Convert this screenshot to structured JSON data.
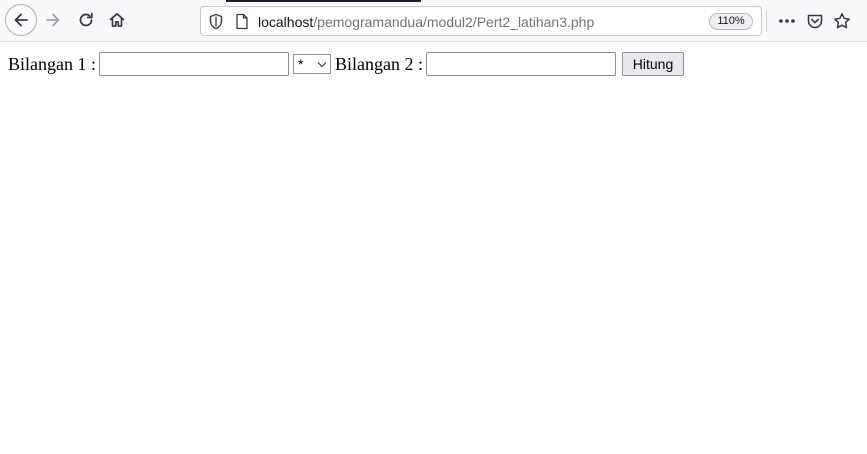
{
  "browser": {
    "url_host": "localhost",
    "url_path": "/pemogramandua/modul2/Pert2_latihan3.php",
    "zoom": "110%",
    "icons": [
      "back-arrow-icon",
      "forward-arrow-icon",
      "reload-icon",
      "home-icon",
      "shield-icon",
      "page-icon",
      "more-icon",
      "pocket-icon",
      "bookmark-star-icon"
    ]
  },
  "form": {
    "label1": "Bilangan 1 :",
    "input1_value": "",
    "operator_selected": "*",
    "label2": "Bilangan 2 :",
    "input2_value": "",
    "submit_label": "Hitung"
  }
}
